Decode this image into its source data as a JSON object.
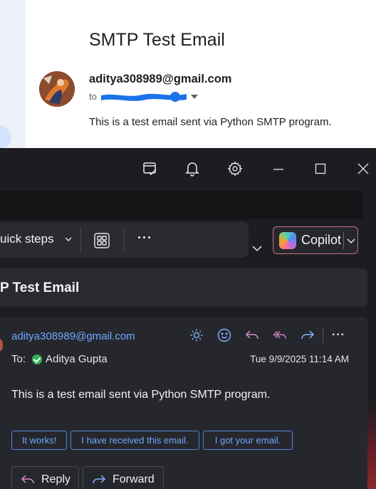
{
  "gmail": {
    "subject": "SMTP Test Email",
    "sender": "aditya308989@gmail.com",
    "to_prefix": "to",
    "body": "This is a test email sent via Python SMTP program."
  },
  "outlook": {
    "ribbon": {
      "quick_steps": "uick steps",
      "more": "···"
    },
    "copilot": {
      "label": "Copilot"
    },
    "subject": "P Test Email",
    "message": {
      "sender": "aditya308989@gmail.com",
      "to_label": "To:",
      "to_name": "Aditya Gupta",
      "date": "Tue 9/9/2025 11:14 AM",
      "body": "This is a test email sent via Python SMTP program.",
      "more": "···"
    },
    "suggestions": [
      "It works!",
      "I have received this email.",
      "I got your email."
    ],
    "actions": {
      "reply": "Reply",
      "forward": "Forward"
    }
  },
  "colors": {
    "accent": "#6ea8ff",
    "copilot_border": "#c86b86",
    "redaction": "#1a73e8"
  },
  "icons": [
    "checklist-icon",
    "bell-icon",
    "gear-icon",
    "minimize-icon",
    "maximize-icon",
    "close-icon",
    "chevron-down-icon",
    "apps-grid-icon",
    "copilot-logo-icon",
    "summarize-icon",
    "emoji-icon",
    "reply-icon",
    "reply-all-icon",
    "forward-icon",
    "check-icon"
  ]
}
